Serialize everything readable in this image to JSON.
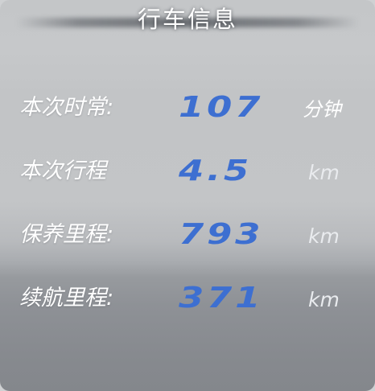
{
  "header": {
    "title": "行车信息"
  },
  "rows": [
    {
      "label": "本次时常:",
      "value": "107",
      "unit": "分钟"
    },
    {
      "label": "本次行程",
      "value": "4.5",
      "unit": "km"
    },
    {
      "label": "保养里程:",
      "value": "793",
      "unit": "km"
    },
    {
      "label": "续航里程:",
      "value": "371",
      "unit": "km"
    }
  ],
  "colors": {
    "value_text": "#3d6fd1",
    "label_text": "#ffffff",
    "panel_top": "#c4c6c8",
    "panel_bottom": "#84878c"
  }
}
